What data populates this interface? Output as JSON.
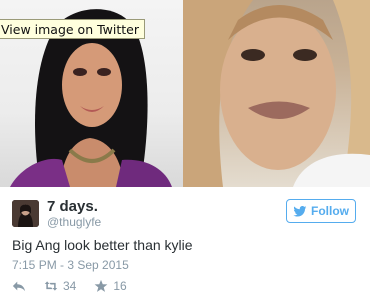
{
  "tooltip": {
    "text": "View image on Twitter"
  },
  "profile": {
    "name": "7 days.",
    "handle": "@thuglyfe"
  },
  "follow_button": {
    "label": "Follow"
  },
  "tweet": {
    "text": "Big Ang look better than kylie",
    "timestamp": "7:15 PM - 3 Sep 2015"
  },
  "actions": {
    "retweet_count": "34",
    "like_count": "16"
  },
  "colors": {
    "accent": "#55acee",
    "muted": "#8899a6",
    "text": "#292f33"
  },
  "icons": [
    "twitter-bird-icon",
    "reply-icon",
    "retweet-icon",
    "star-icon"
  ]
}
